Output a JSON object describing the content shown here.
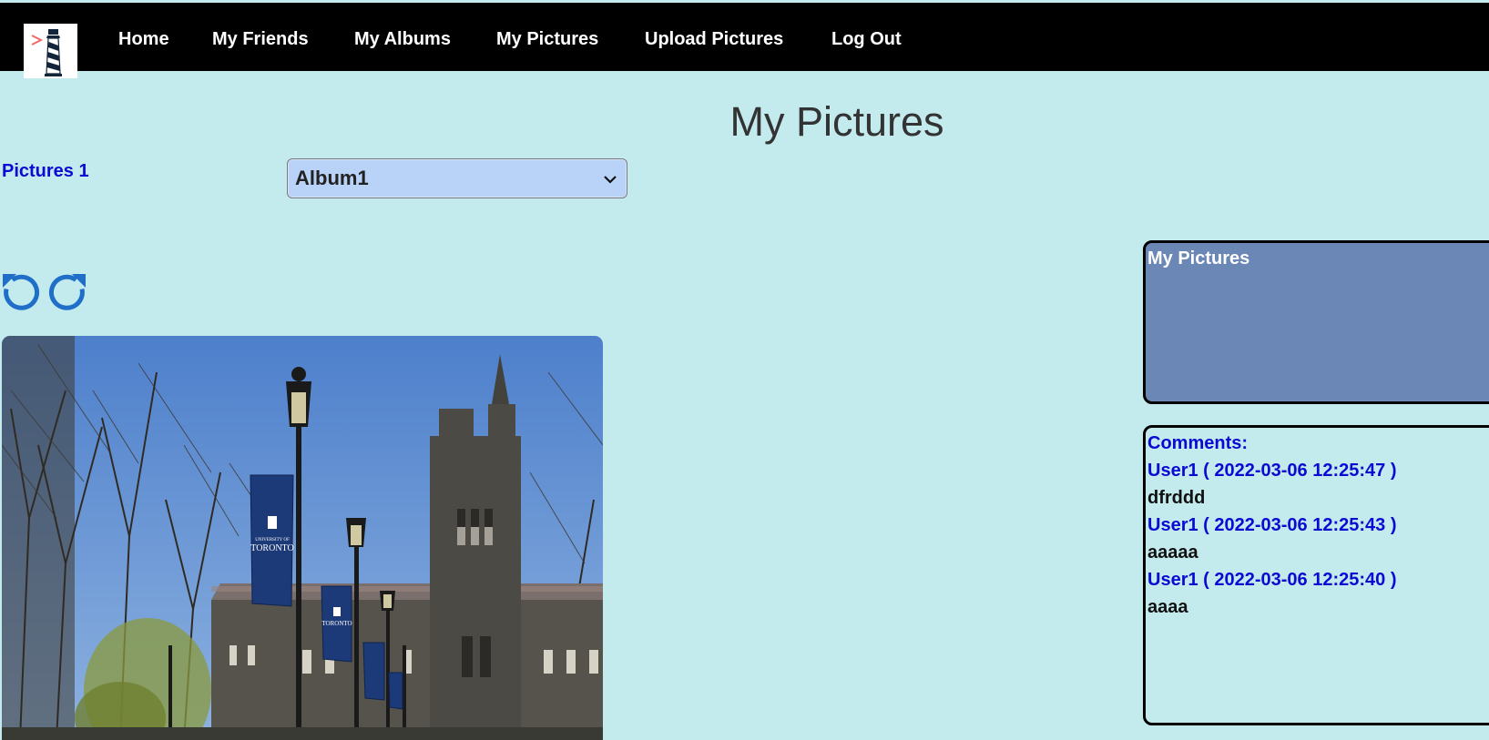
{
  "nav": {
    "items": [
      {
        "label": "Home"
      },
      {
        "label": "My Friends"
      },
      {
        "label": "My Albums"
      },
      {
        "label": "My Pictures"
      },
      {
        "label": "Upload Pictures"
      },
      {
        "label": "Log Out"
      }
    ]
  },
  "page": {
    "title": "My Pictures",
    "pictures_count": "Pictures 1"
  },
  "album_select": {
    "selected": "Album1"
  },
  "picture_panel": {
    "title": "My Pictures"
  },
  "comments": {
    "title": "Comments:",
    "items": [
      {
        "author": "User1 ( 2022-03-06 12:25:47 )",
        "text": "dfrddd"
      },
      {
        "author": "User1 ( 2022-03-06 12:25:43 )",
        "text": "aaaaa"
      },
      {
        "author": "User1 ( 2022-03-06 12:25:40 )",
        "text": "aaaa"
      }
    ]
  },
  "photo_banner": {
    "line1": "UNIVERSITY OF",
    "line2": "TORONTO"
  },
  "colors": {
    "background": "#c3ebee",
    "navbar": "#000000",
    "link": "#0a0ad2",
    "select_bg": "#b9d2f7",
    "panel_bg": "#6a87b5",
    "rotate_icon": "#1f6fc9"
  },
  "icons": {
    "logo": "lighthouse-icon",
    "rotate_left": "rotate-left-icon",
    "rotate_right": "rotate-right-icon",
    "dropdown": "chevron-down-icon"
  }
}
